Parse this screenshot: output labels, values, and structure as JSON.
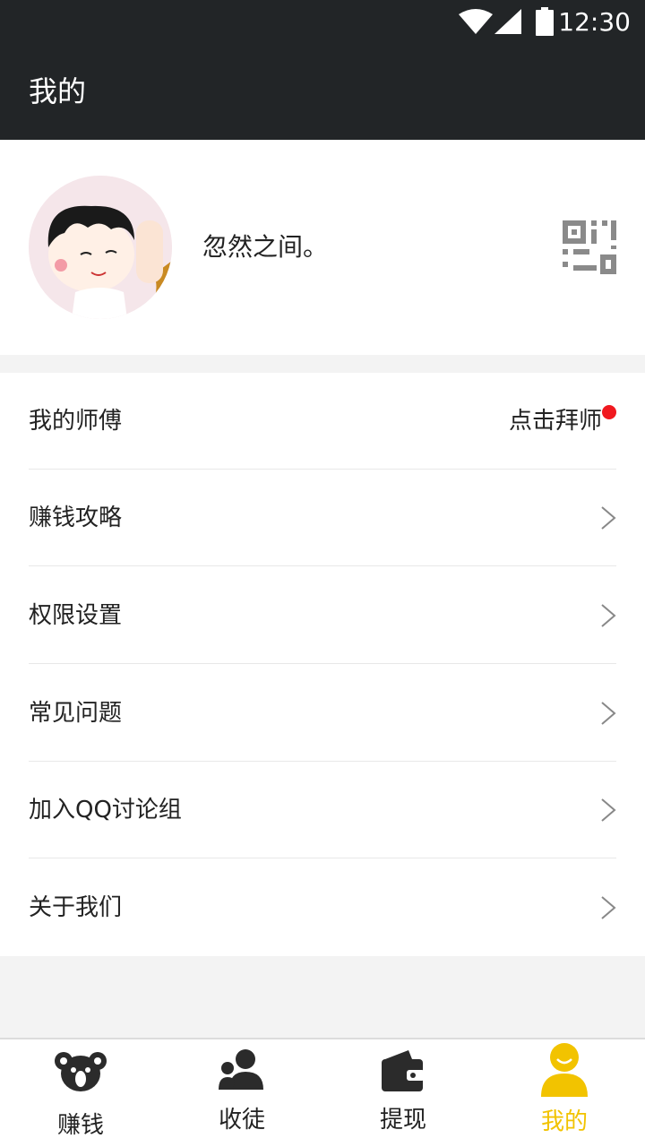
{
  "status_bar": {
    "time": "12:30",
    "icons": [
      "wifi-icon",
      "signal-icon",
      "battery-icon"
    ]
  },
  "header": {
    "title": "我的"
  },
  "profile": {
    "nickname": "忽然之间。",
    "qr_icon": "qr-code-icon"
  },
  "menu": {
    "items": [
      {
        "label": "我的师傅",
        "right_text": "点击拜师",
        "badge": "red-dot"
      },
      {
        "label": "赚钱攻略"
      },
      {
        "label": "权限设置"
      },
      {
        "label": "常见问题"
      },
      {
        "label": "加入QQ讨论组"
      },
      {
        "label": "关于我们"
      }
    ]
  },
  "tabbar": {
    "tabs": [
      {
        "label": "赚钱",
        "icon": "koala-icon"
      },
      {
        "label": "收徒",
        "icon": "users-icon"
      },
      {
        "label": "提现",
        "icon": "wallet-icon"
      },
      {
        "label": "我的",
        "icon": "user-icon",
        "active": true
      }
    ]
  },
  "colors": {
    "header_bg": "#222527",
    "accent": "#f2c300",
    "badge": "#f0191f"
  }
}
